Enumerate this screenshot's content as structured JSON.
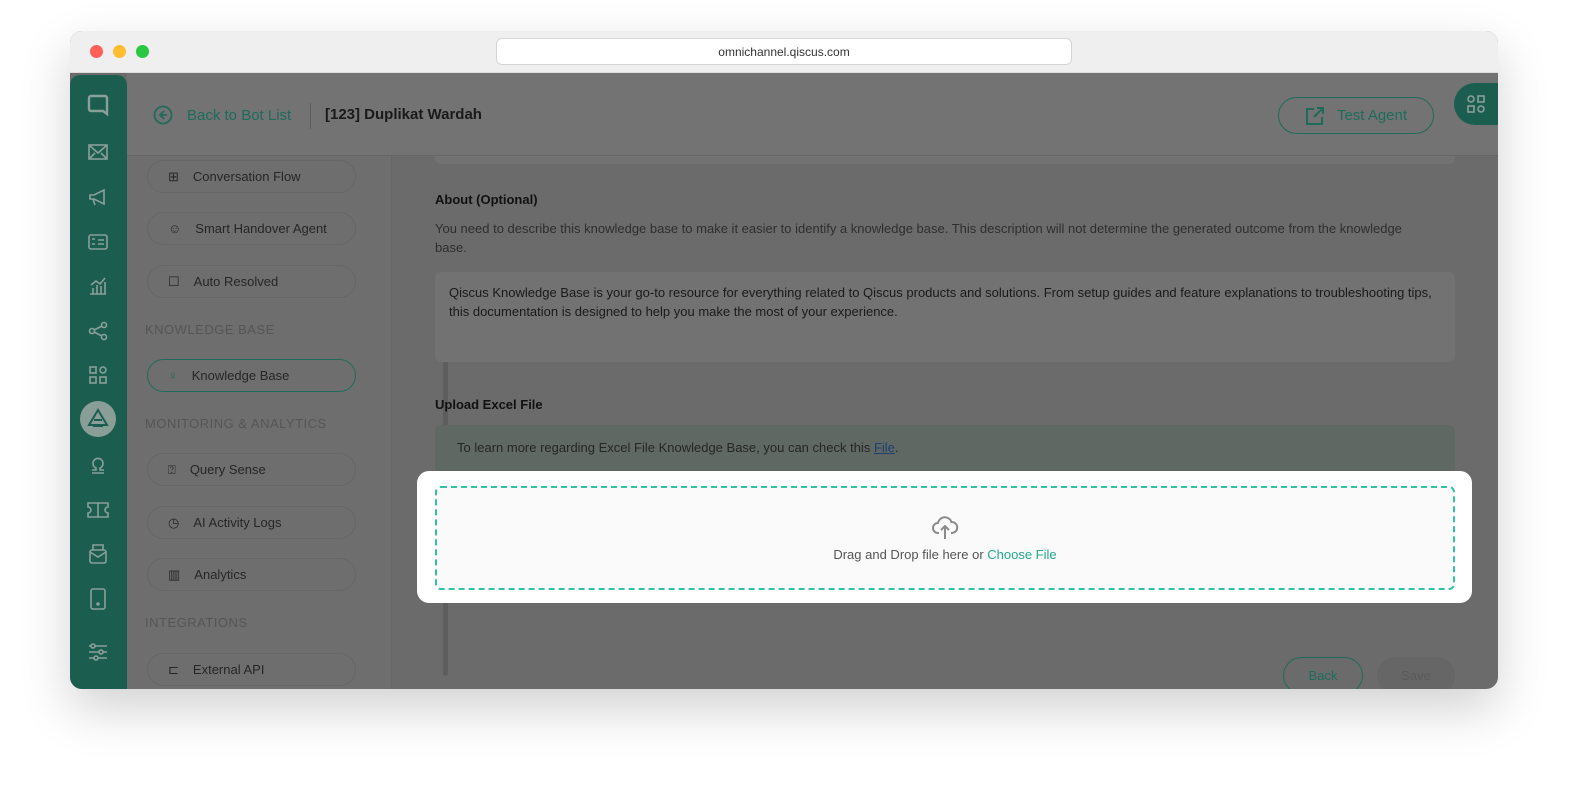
{
  "browser": {
    "url": "omnichannel.qiscus.com"
  },
  "header": {
    "back_label": "Back to Bot List",
    "bot_title": "[123] Duplikat Wardah",
    "test_agent_label": "Test Agent"
  },
  "sidebar": {
    "items_top": [
      {
        "label": "Conversation Flow",
        "icon": "sitemap-icon"
      },
      {
        "label": "Smart Handover Agent",
        "icon": "user-check-icon"
      },
      {
        "label": "Auto Resolved",
        "icon": "chat-bot-icon"
      }
    ],
    "sections": [
      {
        "title": "KNOWLEDGE BASE",
        "items": [
          {
            "label": "Knowledge Base",
            "icon": "lightbulb-icon",
            "active": true
          }
        ]
      },
      {
        "title": "MONITORING & ANALYTICS",
        "items": [
          {
            "label": "Query Sense",
            "icon": "question-chat-icon"
          },
          {
            "label": "AI Activity Logs",
            "icon": "clock-icon"
          },
          {
            "label": "Analytics",
            "icon": "chart-icon"
          }
        ]
      },
      {
        "title": "INTEGRATIONS",
        "items": [
          {
            "label": "External API",
            "icon": "api-icon"
          }
        ]
      }
    ]
  },
  "main": {
    "about_label": "About (Optional)",
    "about_help": "You need to describe this knowledge base to make it easier to identify a knowledge base. This description will not determine the generated outcome from the knowledge base.",
    "about_value": "Qiscus Knowledge Base is your go-to resource for everything related to Qiscus products and solutions. From setup guides and feature explanations to troubleshooting tips, this documentation is designed to help you make the most of your experience.",
    "upload_label": "Upload Excel File",
    "info_text": "To learn more regarding Excel File Knowledge Base, you can check this ",
    "info_link": "File",
    "info_end": ".",
    "drop_text": "Drag and Drop file here or ",
    "choose_file": "Choose File",
    "back_button": "Back",
    "save_button": "Save"
  },
  "colors": {
    "brand": "#27b199",
    "accent": "#33c1a4"
  }
}
